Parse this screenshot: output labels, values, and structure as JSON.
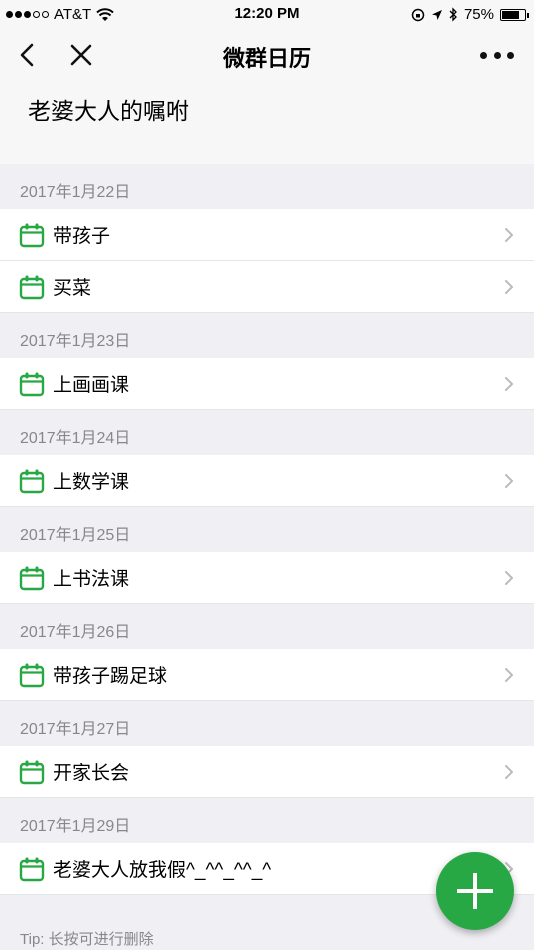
{
  "status_bar": {
    "carrier": "AT&T",
    "time": "12:20 PM",
    "battery": "75%",
    "battery_level": 0.75
  },
  "nav": {
    "title": "微群日历"
  },
  "page": {
    "heading": "老婆大人的嘱咐"
  },
  "groups": [
    {
      "date": "2017年1月22日",
      "items": [
        "带孩子",
        "买菜"
      ]
    },
    {
      "date": "2017年1月23日",
      "items": [
        "上画画课"
      ]
    },
    {
      "date": "2017年1月24日",
      "items": [
        "上数学课"
      ]
    },
    {
      "date": "2017年1月25日",
      "items": [
        "上书法课"
      ]
    },
    {
      "date": "2017年1月26日",
      "items": [
        "带孩子踢足球"
      ]
    },
    {
      "date": "2017年1月27日",
      "items": [
        "开家长会"
      ]
    },
    {
      "date": "2017年1月29日",
      "items": [
        "老婆大人放我假^_^^_^^_^"
      ]
    }
  ],
  "tip": "Tip: 长按可进行删除",
  "colors": {
    "accent_green": "#27a844",
    "background": "#efeff4"
  },
  "icons": {
    "row_icon": "calendar-icon",
    "row_chevron": "chevron-right-icon",
    "fab": "plus-icon"
  }
}
